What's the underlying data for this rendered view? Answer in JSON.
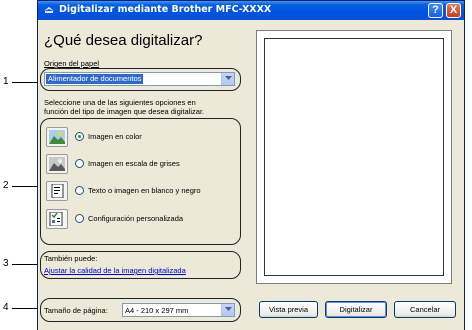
{
  "window": {
    "title": "Digitalizar mediante Brother MFC-XXXX",
    "help_label": "?",
    "close_label": "X"
  },
  "main": {
    "heading": "¿Qué desea digitalizar?",
    "source_label": "Origen del papel",
    "source_value": "Alimentador de documentos",
    "instructions_line1": "Seleccione una de las siguientes opciones en",
    "instructions_line2": "función del tipo de imagen que desea digitalizar.",
    "options": [
      {
        "label": "Imagen en color",
        "checked": true,
        "icon": "color-photo-icon"
      },
      {
        "label": "Imagen en escala de grises",
        "checked": false,
        "icon": "grayscale-photo-icon"
      },
      {
        "label": "Texto o imagen en blanco y negro",
        "checked": false,
        "icon": "text-document-icon"
      },
      {
        "label": "Configuración personalizada",
        "checked": false,
        "icon": "custom-settings-icon"
      }
    ],
    "also_label": "También puede:",
    "adjust_link": "Ajustar la calidad de la imagen digitalizada",
    "page_size_label": "Tamaño de página:",
    "page_size_value": "A4 - 210 x 297 mm"
  },
  "buttons": {
    "preview": "Vista previa",
    "scan": "Digitalizar",
    "cancel": "Cancelar"
  },
  "callouts": [
    "1",
    "2",
    "3",
    "4"
  ]
}
